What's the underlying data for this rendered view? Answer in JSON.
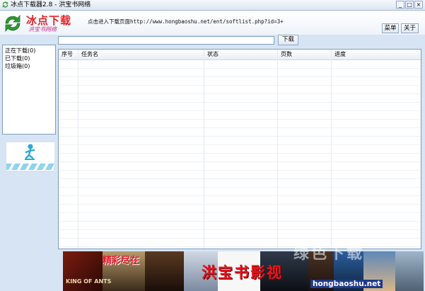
{
  "window": {
    "title": "冰点下载器2.8 - 洪宝书网络",
    "minimize": "_",
    "maximize": "□",
    "close": "×"
  },
  "header": {
    "logo_title": "冰点下载",
    "logo_subtitle": "洪宝书网络",
    "hint": "点击进入下载页面http://www.hongbaoshu.net/ent/softlist.php?id=3+",
    "menu_label": "菜单",
    "about_label": "关于"
  },
  "toolbar": {
    "url_value": "",
    "download_label": "下载"
  },
  "sidebar": {
    "items": [
      {
        "label": "正在下载(0)"
      },
      {
        "label": "已下载(0)"
      },
      {
        "label": "垃圾箱(0)"
      }
    ]
  },
  "table": {
    "columns": [
      "序号",
      "任务名",
      "状态",
      "页数",
      "进度"
    ],
    "rows": []
  },
  "banner": {
    "slogan": "精彩尽在",
    "name": "洪宝书影视",
    "url": "hongbaoshu.net",
    "poster_caption": "KING OF ANTS"
  },
  "watermark": "绿色下载",
  "colors": {
    "accent": "#e0262b",
    "background": "#d6e4f4",
    "border": "#7f9db9"
  }
}
